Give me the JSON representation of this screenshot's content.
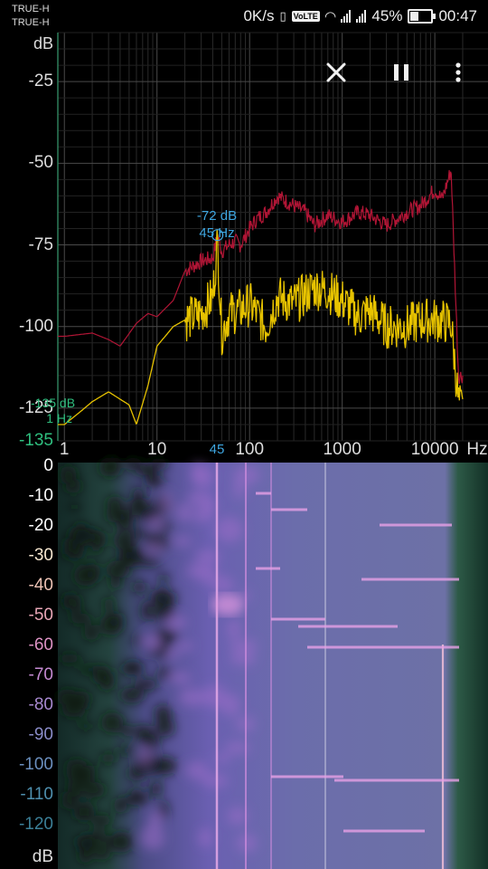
{
  "status_bar": {
    "carrier_1": "TRUE-H",
    "carrier_2": "TRUE-H",
    "net_speed": "0K/s",
    "volte": "VoLTE",
    "battery_percent": "45%",
    "battery_level": 0.45,
    "time": "00:47"
  },
  "controls": {
    "close_icon": "close-icon",
    "pause_icon": "pause-icon",
    "menu_icon": "more-vert-icon"
  },
  "spectrum": {
    "y_unit": "dB",
    "x_unit": "Hz",
    "y_ticks": [
      "-25",
      "-50",
      "-75",
      "-100",
      "-125",
      "-135"
    ],
    "x_ticks": [
      "1",
      "10",
      "100",
      "1000",
      "10000"
    ],
    "peak_label_db": "-72 dB",
    "peak_label_hz": "45 Hz",
    "peak_marker_freq": "45",
    "cursor_label_db": "-135 dB",
    "cursor_label_hz": "1 Hz",
    "colors": {
      "background": "#000000",
      "grid": "#3a3a3a",
      "peak_trace": "#b01535",
      "current_trace": "#e6c200",
      "annotation": "#3ea6e0",
      "cursor": "#2fbf7f"
    }
  },
  "spectrogram": {
    "y_unit": "dB",
    "db_scale": [
      "0",
      "-10",
      "-20",
      "-30",
      "-40",
      "-50",
      "-60",
      "-70",
      "-80",
      "-90",
      "-100",
      "-110",
      "-120"
    ],
    "scale_colors": [
      "#ffffff",
      "#ffffff",
      "#ffffff",
      "#f6e6cf",
      "#ecc2b4",
      "#e8a6b6",
      "#dd92c4",
      "#c58ad2",
      "#a889d0",
      "#8a8cc8",
      "#6b8fbe",
      "#4e8fae",
      "#3b7f97"
    ]
  },
  "chart_data": {
    "type": "line",
    "xlabel": "Hz",
    "ylabel": "dB",
    "x_scale": "log",
    "xlim": [
      0.85,
      20000
    ],
    "ylim": [
      -135,
      -10
    ],
    "grid": true,
    "annotations": [
      {
        "text": "-72 dB 45 Hz",
        "x": 45,
        "y": -72
      },
      {
        "text": "-135 dB 1 Hz",
        "x": 1,
        "y": -135
      }
    ],
    "series": [
      {
        "role": "peak-hold",
        "x": [
          1,
          2,
          3,
          4,
          6,
          8,
          10,
          15,
          20,
          30,
          40,
          45,
          50,
          60,
          70,
          80,
          100,
          120,
          150,
          200,
          300,
          400,
          500,
          700,
          1000,
          1500,
          2000,
          3000,
          5000,
          7000,
          10000,
          12000,
          15000,
          18000,
          20000
        ],
        "values": [
          -103,
          -102,
          -104,
          -106,
          -99,
          -96,
          -97,
          -92,
          -83,
          -80,
          -79,
          -72,
          -77,
          -75,
          -74,
          -75,
          -70,
          -67,
          -65,
          -60,
          -63,
          -65,
          -69,
          -66,
          -68,
          -65,
          -66,
          -69,
          -65,
          -63,
          -58,
          -61,
          -52,
          -115,
          -115
        ]
      },
      {
        "role": "current",
        "x": [
          1,
          1.5,
          2,
          3,
          5,
          6,
          8,
          10,
          15,
          20,
          30,
          40,
          45,
          50,
          60,
          80,
          100,
          150,
          200,
          300,
          500,
          700,
          1000,
          1500,
          2000,
          3000,
          5000,
          7000,
          10000,
          15000,
          18000,
          20000
        ],
        "values": [
          -130,
          -126,
          -123,
          -120,
          -124,
          -130,
          -118,
          -106,
          -100,
          -98,
          -96,
          -91,
          -74,
          -102,
          -96,
          -95,
          -93,
          -100,
          -91,
          -93,
          -88,
          -89,
          -92,
          -97,
          -95,
          -100,
          -100,
          -98,
          -98,
          -99,
          -123,
          -126
        ]
      }
    ]
  }
}
